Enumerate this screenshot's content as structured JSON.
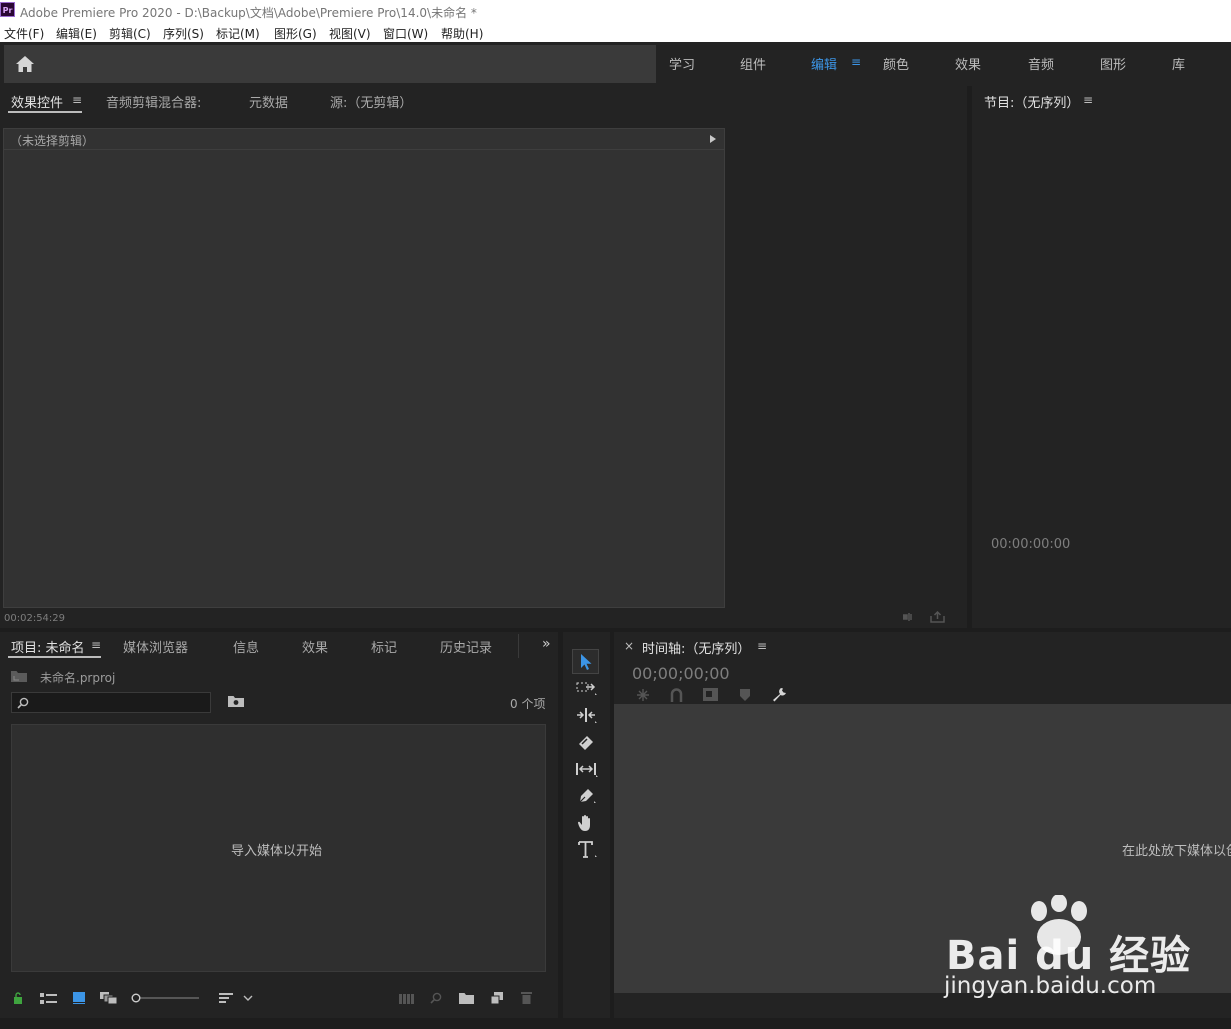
{
  "window": {
    "title": "Adobe Premiere Pro 2020 - D:\\Backup\\文档\\Adobe\\Premiere Pro\\14.0\\未命名 *",
    "logo": "Pr"
  },
  "menu": [
    "文件(F)",
    "编辑(E)",
    "剪辑(C)",
    "序列(S)",
    "标记(M)",
    "图形(G)",
    "视图(V)",
    "窗口(W)",
    "帮助(H)"
  ],
  "workspaces": {
    "items": [
      "学习",
      "组件",
      "编辑",
      "颜色",
      "效果",
      "音频",
      "图形",
      "库"
    ],
    "active": "编辑"
  },
  "source_panel": {
    "tabs": [
      "效果控件",
      "音频剪辑混合器:",
      "元数据",
      "源:（无剪辑）"
    ],
    "no_clip_label": "（未选择剪辑）",
    "timecode": "00:02:54:29"
  },
  "program_panel": {
    "title": "节目:（无序列）",
    "timecode": "00:00:00:00"
  },
  "project_panel": {
    "tabs": [
      "项目: 未命名",
      "媒体浏览器",
      "信息",
      "效果",
      "标记",
      "历史记录"
    ],
    "filename": "未命名.prproj",
    "search_placeholder": "",
    "item_count": "0 个项",
    "empty_message": "导入媒体以开始"
  },
  "timeline_panel": {
    "close": "×",
    "title": "时间轴:（无序列）",
    "timecode": "00;00;00;00",
    "drop_message": "在此处放下媒体以创"
  },
  "watermark": {
    "brand": "Bai du 经验",
    "url": "jingyan.baidu.com"
  },
  "colors": {
    "accent": "#3c95e6",
    "panel_bg": "#232323",
    "frame_bg": "#1d1d1d"
  },
  "icons": [
    "home-icon",
    "panel-menu-icon",
    "play-right-icon",
    "folder-icon",
    "search-icon",
    "new-bin-icon",
    "lock-icon",
    "list-view-icon",
    "icon-view-icon",
    "freeform-view-icon",
    "zoom-slider-icon",
    "sort-icon",
    "automate-icon",
    "find-icon",
    "new-item-icon",
    "clear-icon",
    "selection-tool-icon",
    "track-select-tool-icon",
    "ripple-edit-tool-icon",
    "razor-tool-icon",
    "slip-tool-icon",
    "pen-tool-icon",
    "hand-tool-icon",
    "type-tool-icon",
    "overflow-icon",
    "snap-icon",
    "linked-icon",
    "marker-icon",
    "settings-wrench-icon"
  ]
}
